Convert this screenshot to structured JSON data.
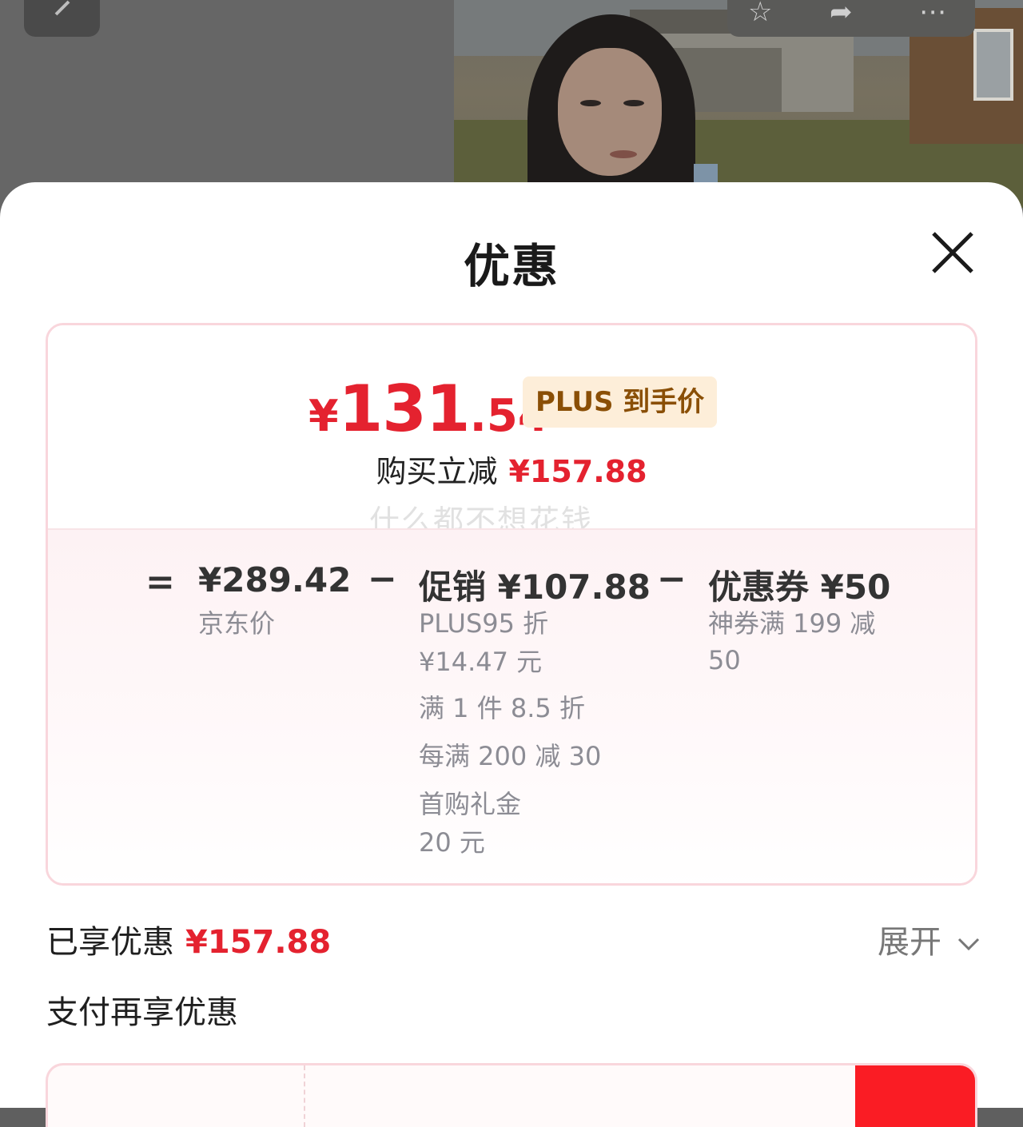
{
  "header": {
    "back_icon": "chevron-left-icon",
    "actions": [
      "star-icon",
      "share-icon",
      "more-icon"
    ]
  },
  "sheet": {
    "title": "优惠",
    "close_icon": "close-icon"
  },
  "price_summary": {
    "final_price_yen": "¥",
    "final_price_int": "131",
    "final_price_dec": ".54",
    "final_price_badge": "PLUS 到手价",
    "instant_off_label": "购买立减",
    "instant_off_value": "¥157.88",
    "watermark": "什么都不想花钱"
  },
  "breakdown": {
    "equals": "=",
    "minus": "−",
    "jd_price": {
      "amount": "¥289.42",
      "label": "京东价"
    },
    "promotion": {
      "title": "促销 ¥107.88",
      "details": [
        "PLUS95 折",
        "¥14.47 元",
        "满 1 件 8.5 折",
        "每满 200 减 30",
        "首购礼金",
        "20 元"
      ]
    },
    "coupon": {
      "title": "优惠券 ¥50",
      "details": [
        "神券满 199 减",
        "50"
      ]
    }
  },
  "enjoyed": {
    "label": "已享优惠",
    "value": "¥157.88",
    "expand_label": "展开",
    "expand_icon": "chevron-down-icon"
  },
  "payment": {
    "label": "支付再享优惠"
  },
  "colors": {
    "accent_red": "#e4222f",
    "badge_bg": "#fdeed9",
    "badge_text": "#8a4f06",
    "card_border": "#f9d6dc"
  }
}
